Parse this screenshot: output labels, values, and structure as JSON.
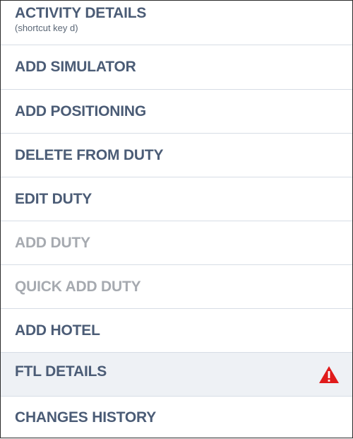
{
  "menu": {
    "items": [
      {
        "label": "ACTIVITY DETAILS",
        "sublabel": "(shortcut key d)",
        "enabled": true
      },
      {
        "label": "ADD SIMULATOR",
        "enabled": true
      },
      {
        "label": "ADD POSITIONING",
        "enabled": true
      },
      {
        "label": "DELETE FROM DUTY",
        "enabled": true
      },
      {
        "label": "EDIT DUTY",
        "enabled": true
      },
      {
        "label": "ADD DUTY",
        "enabled": false
      },
      {
        "label": "QUICK ADD DUTY",
        "enabled": false
      },
      {
        "label": "ADD HOTEL",
        "enabled": true
      },
      {
        "label": "FTL DETAILS",
        "enabled": true,
        "highlighted": true,
        "icon": "warning-icon"
      },
      {
        "label": "CHANGES HISTORY",
        "enabled": true
      }
    ]
  },
  "colors": {
    "text": "#4b5c76",
    "disabled_text": "#a6aab0",
    "divider": "#d7dde5",
    "highlight_bg": "#eef1f5",
    "warning": "#e01b1b"
  }
}
